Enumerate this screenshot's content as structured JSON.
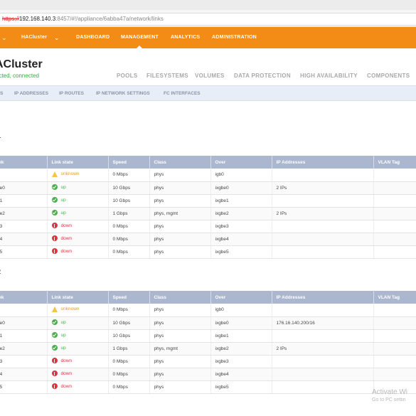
{
  "browser": {
    "url_scheme": "https://",
    "url_host": "192.168.140.3",
    "url_path": ":8457/#!/appliance/6abba47a/network/links"
  },
  "topnav": {
    "cluster": "HACluster",
    "items": [
      "DASHBOARD",
      "MANAGEMENT",
      "ANALYTICS",
      "ADMINISTRATION"
    ],
    "active": "MANAGEMENT"
  },
  "header": {
    "title": "ACluster",
    "status": "ected, connected",
    "tabs": [
      "POOLS",
      "FILESYSTEMS",
      "VOLUMES",
      "DATA PROTECTION",
      "HIGH AVAILABILITY",
      "COMPONENTS"
    ]
  },
  "subnav": [
    "S",
    "IP ADDRESSES",
    "IP ROUTES",
    "IP NETWORK SETTINGS",
    "FC INTERFACES"
  ],
  "columns": [
    "ink",
    "Link state",
    "Speed",
    "Class",
    "Over",
    "IP Addresses",
    "VLAN Tag"
  ],
  "nodes": [
    {
      "title": "1",
      "rows": [
        {
          "link": "",
          "state": "unknown",
          "speed": "0 Mbps",
          "class": "phys",
          "over": "igb0",
          "ip": "",
          "vlan": ""
        },
        {
          "link": "be0",
          "state": "up",
          "speed": "10 Gbps",
          "class": "phys",
          "over": "ixgbe0",
          "ip": "2 IPs",
          "vlan": ""
        },
        {
          "link": "e1",
          "state": "up",
          "speed": "10 Gbps",
          "class": "phys",
          "over": "ixgbe1",
          "ip": "",
          "vlan": ""
        },
        {
          "link": "be2",
          "state": "up",
          "speed": "1 Gbps",
          "class": "phys, mgmt",
          "over": "ixgbe2",
          "ip": "2 IPs",
          "vlan": ""
        },
        {
          "link": "e3",
          "state": "down",
          "speed": "0 Mbps",
          "class": "phys",
          "over": "ixgbe3",
          "ip": "",
          "vlan": ""
        },
        {
          "link": "e4",
          "state": "down",
          "speed": "0 Mbps",
          "class": "phys",
          "over": "ixgbe4",
          "ip": "",
          "vlan": ""
        },
        {
          "link": "e5",
          "state": "down",
          "speed": "0 Mbps",
          "class": "phys",
          "over": "ixgbe5",
          "ip": "",
          "vlan": ""
        }
      ]
    },
    {
      "title": "2",
      "rows": [
        {
          "link": "",
          "state": "unknown",
          "speed": "0 Mbps",
          "class": "phys",
          "over": "igb0",
          "ip": "",
          "vlan": ""
        },
        {
          "link": "be0",
          "state": "up",
          "speed": "10 Gbps",
          "class": "phys",
          "over": "ixgbe0",
          "ip": "176.16.140.200/16",
          "vlan": ""
        },
        {
          "link": "e1",
          "state": "up",
          "speed": "10 Gbps",
          "class": "phys",
          "over": "ixgbe1",
          "ip": "",
          "vlan": ""
        },
        {
          "link": "be2",
          "state": "up",
          "speed": "1 Gbps",
          "class": "phys, mgmt",
          "over": "ixgbe2",
          "ip": "2 IPs",
          "vlan": ""
        },
        {
          "link": "e3",
          "state": "down",
          "speed": "0 Mbps",
          "class": "phys",
          "over": "ixgbe3",
          "ip": "",
          "vlan": ""
        },
        {
          "link": "e4",
          "state": "down",
          "speed": "0 Mbps",
          "class": "phys",
          "over": "ixgbe4",
          "ip": "",
          "vlan": ""
        },
        {
          "link": "e5",
          "state": "down",
          "speed": "0 Mbps",
          "class": "phys",
          "over": "ixgbe5",
          "ip": "",
          "vlan": ""
        }
      ]
    }
  ],
  "watermark": {
    "line1": "Activate Wi",
    "line2": "Go to PC settin"
  },
  "colors": {
    "accent": "#f28c17",
    "table_header": "#aab7cf",
    "status_up": "#4cae4c",
    "status_down": "#d9363e",
    "status_unknown": "#e0a326",
    "connected": "#38a83a"
  }
}
